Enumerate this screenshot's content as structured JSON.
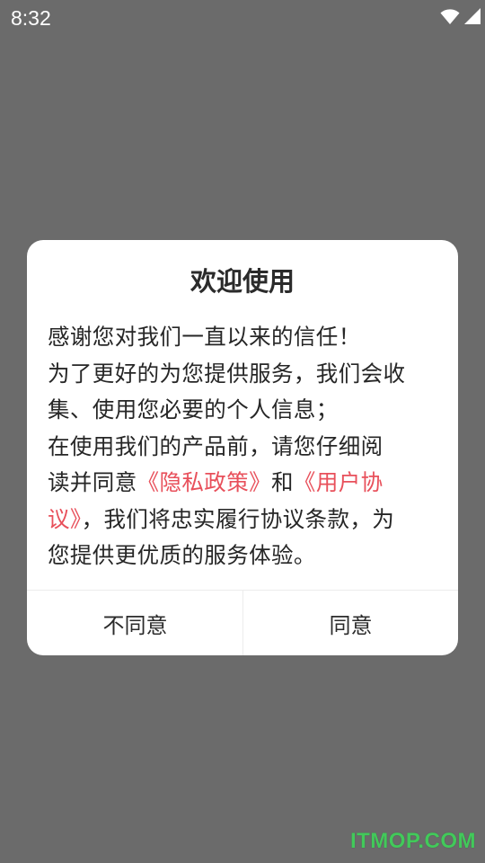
{
  "status_bar": {
    "time": "8:32",
    "icons": [
      "wifi-icon",
      "signal-icon",
      "battery-charging-icon"
    ]
  },
  "dialog": {
    "title": "欢迎使用",
    "lines": {
      "l1": "感谢您对我们一直以来的信任！",
      "l2": "为了更好的为您提供服务，我们会收",
      "l3": "集、使用您必要的个人信息；",
      "l4": "在使用我们的产品前，请您仔细阅",
      "l5_prefix": "读并同意",
      "privacy_link": "《隐私政策》",
      "l5_and": "和",
      "agreement_link_part1": "《用户协",
      "agreement_link_part2": "议》",
      "l6_rest": "，我们将忠实履行协议条款，为",
      "l7": "您提供更优质的服务体验。"
    },
    "buttons": {
      "disagree": "不同意",
      "agree": "同意"
    }
  },
  "watermark": "ITMOP.COM",
  "colors": {
    "overlay_bg": "#6b6b6b",
    "link": "#e8505b",
    "text": "#262626",
    "watermark": "#42c95a"
  }
}
